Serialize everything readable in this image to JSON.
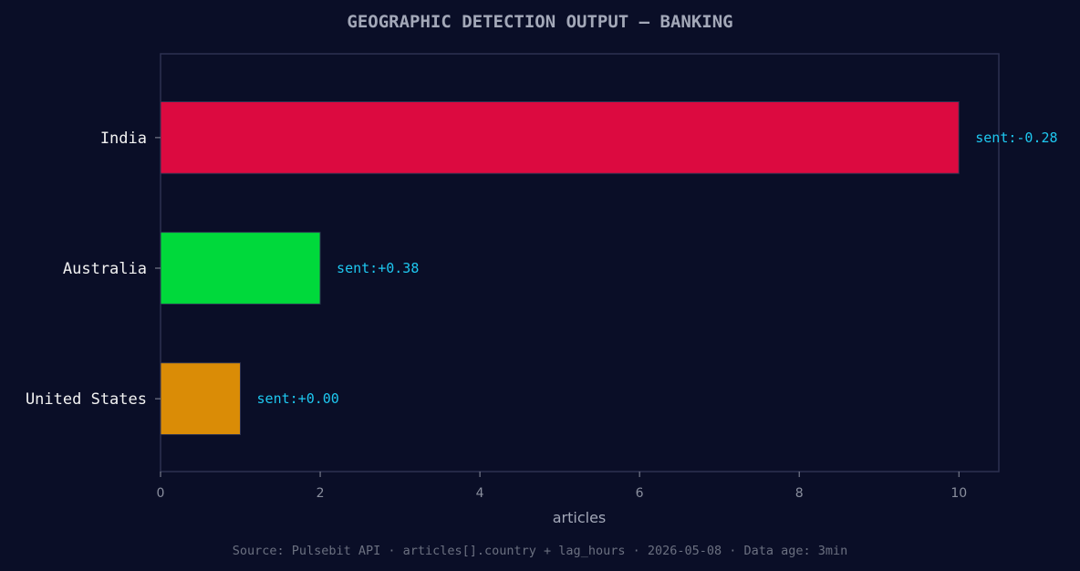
{
  "chart_data": {
    "type": "bar",
    "orientation": "horizontal",
    "title": "GEOGRAPHIC DETECTION OUTPUT — BANKING",
    "xlabel": "articles",
    "ylabel": "",
    "xlim": [
      0,
      10.5
    ],
    "xticks": [
      0,
      2,
      4,
      6,
      8,
      10
    ],
    "grid": false,
    "categories": [
      "India",
      "Australia",
      "United States"
    ],
    "values": [
      10,
      2,
      1
    ],
    "bar_colors": [
      "#dc0a40",
      "#00d93b",
      "#da8c06"
    ],
    "annotations": [
      "sent:-0.28",
      "sent:+0.38",
      "sent:+0.00"
    ],
    "annotation_color": "#1ec8f0",
    "footer": "Source: Pulsebit API · articles[].country + lag_hours · 2026-05-08 · Data age: 3min"
  },
  "colors": {
    "background": "#0a0e27",
    "axes_border": "#2c3150",
    "title": "#a3a8b8",
    "tick_text": "#8a8f9e",
    "category_text": "#f2f2f2",
    "footer_text": "#6b7080"
  }
}
